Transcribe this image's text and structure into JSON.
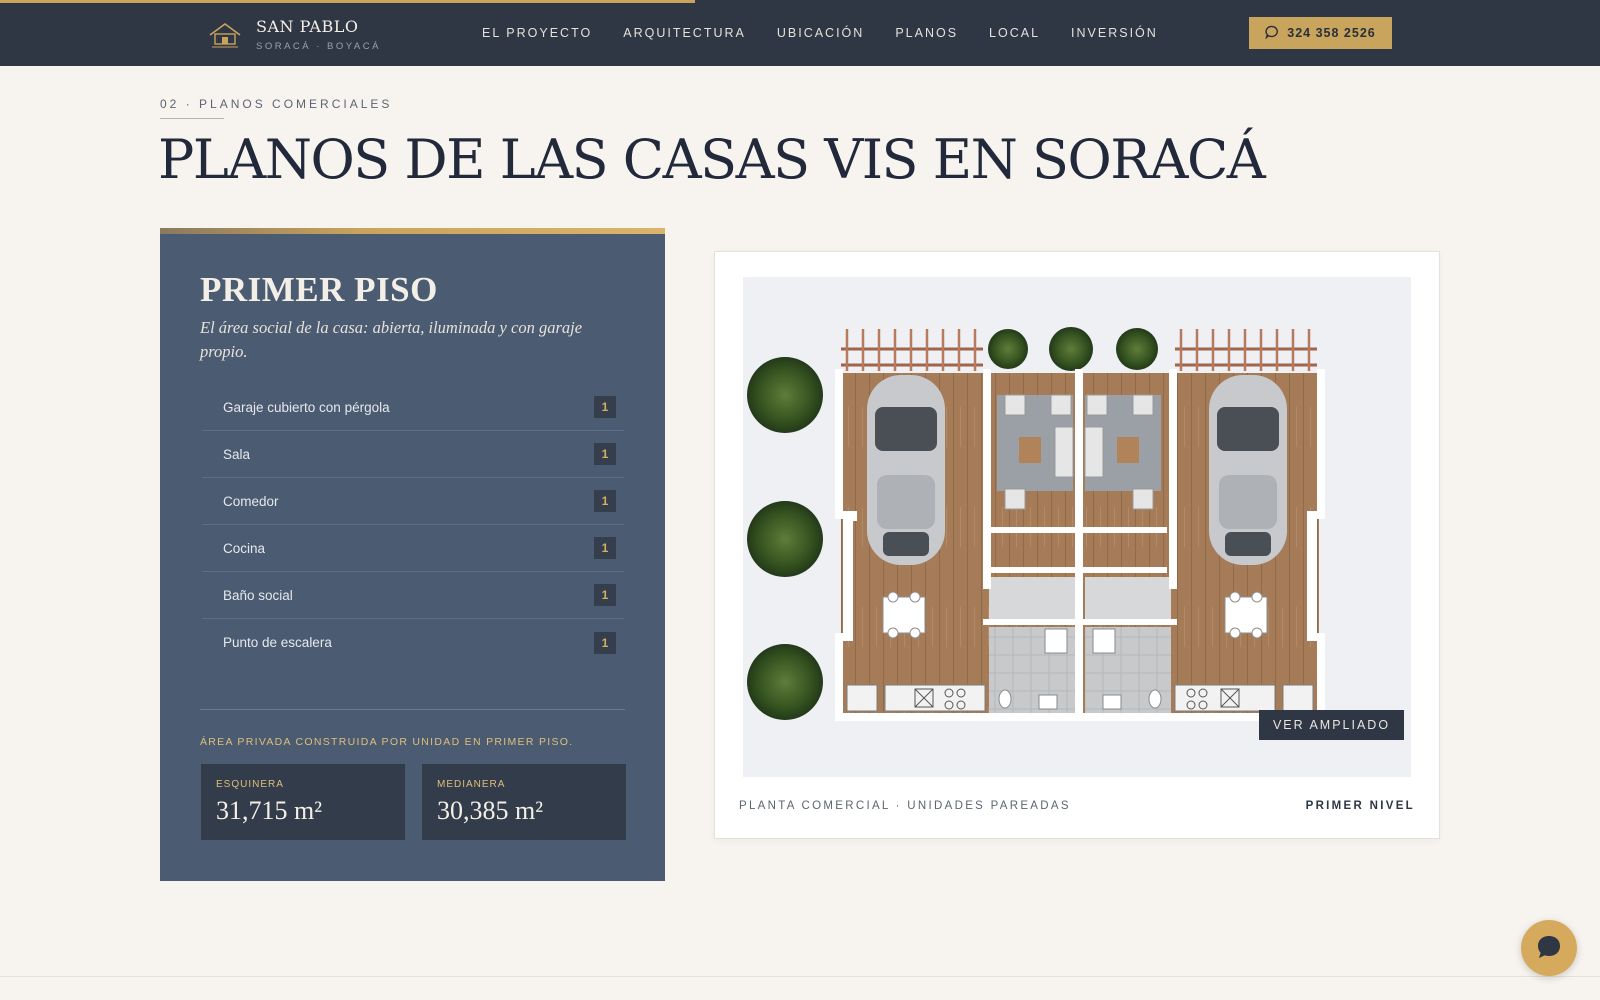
{
  "nav": {
    "brand_name": "SAN PABLO",
    "brand_sub": "SORACÁ · BOYACÁ",
    "links": [
      "EL PROYECTO",
      "ARQUITECTURA",
      "UBICACIÓN",
      "PLANOS",
      "LOCAL",
      "INVERSIÓN"
    ],
    "phone": "324 358 2526"
  },
  "section": {
    "eyebrow": "02 · PLANOS COMERCIALES",
    "title": "PLANOS DE LAS CASAS VIS EN SORACÁ"
  },
  "floor": {
    "title": "PRIMER PISO",
    "subtitle": "El área social de la casa: abierta, iluminada y con garaje propio.",
    "items": [
      {
        "label": "Garaje cubierto con pérgola",
        "count": "1"
      },
      {
        "label": "Sala",
        "count": "1"
      },
      {
        "label": "Comedor",
        "count": "1"
      },
      {
        "label": "Cocina",
        "count": "1"
      },
      {
        "label": "Baño social",
        "count": "1"
      },
      {
        "label": "Punto de escalera",
        "count": "1"
      }
    ],
    "area_label": "ÁREA PRIVADA CONSTRUIDA POR UNIDAD EN PRIMER PISO.",
    "metrics": [
      {
        "label": "ESQUINERA",
        "value": "31,715 m²"
      },
      {
        "label": "MEDIANERA",
        "value": "30,385 m²"
      }
    ]
  },
  "plan": {
    "zoom_label": "VER AMPLIADO",
    "caption_left": "PLANTA COMERCIAL · UNIDADES PAREADAS",
    "caption_right": "PRIMER NIVEL"
  },
  "colors": {
    "nav_bg": "#2f3644",
    "accent_gold": "#c9a45c",
    "panel_bg": "#4a5b72",
    "page_bg": "#f7f4ef"
  },
  "icons": {
    "cta": "chat-bubble-icon",
    "floating": "chat-bubble-icon",
    "logo": "house-logo-icon"
  }
}
